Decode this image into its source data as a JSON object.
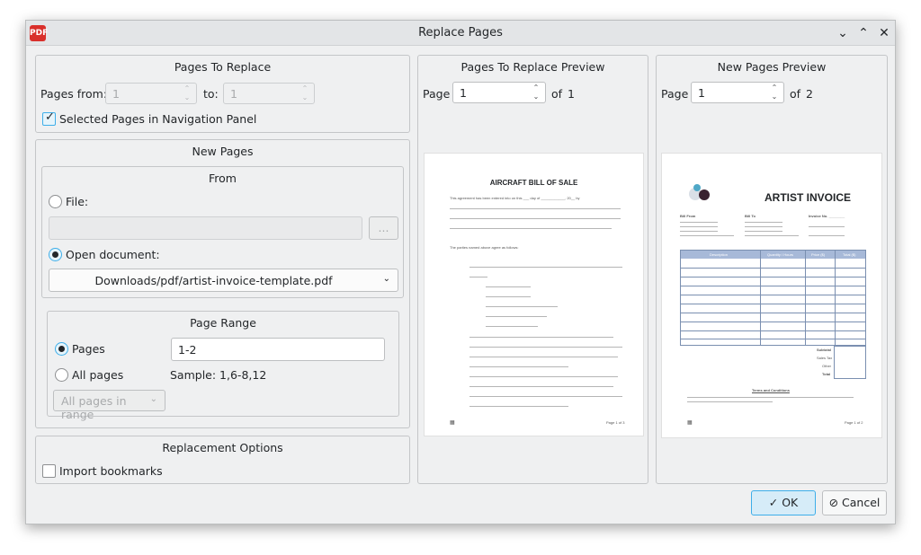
{
  "window": {
    "title": "Replace Pages",
    "app_icon": "pdf-app-icon",
    "controls": [
      "minimize",
      "maximize",
      "close"
    ]
  },
  "pages_to_replace": {
    "title": "Pages To Replace",
    "from_label": "Pages from:",
    "from_value": "1",
    "to_label": "to:",
    "to_value": "1",
    "selected_pages_label": "Selected Pages in Navigation Panel",
    "selected_pages_checked": true
  },
  "new_pages": {
    "title": "New Pages",
    "from_title": "From",
    "file_label": "File:",
    "file_value": "",
    "browse_label": "...",
    "open_document_label": "Open document:",
    "open_document_value": "Downloads/pdf/artist-invoice-template.pdf",
    "page_range": {
      "title": "Page Range",
      "pages_label": "Pages",
      "pages_value": "1-2",
      "all_pages_label": "All pages",
      "sample_label": "Sample: 1,6-8,12",
      "filter_value": "All pages in range"
    }
  },
  "replacement_options": {
    "title": "Replacement Options",
    "import_bookmarks_label": "Import bookmarks",
    "import_bookmarks_checked": false
  },
  "replace_preview": {
    "title": "Pages To Replace Preview",
    "page_label": "Page",
    "page_value": "1",
    "of_label": "of",
    "total": "1",
    "doc": {
      "title": "AIRCRAFT BILL OF SALE",
      "intro": "This agreement has been entered into on this ___ day of ____________, 20__ by",
      "parties": "The parties named above agree as follows:",
      "footer": "Page 1 of 3"
    }
  },
  "new_preview": {
    "title": "New Pages Preview",
    "page_label": "Page",
    "page_value": "1",
    "of_label": "of",
    "total": "2",
    "doc": {
      "title": "ARTIST INVOICE",
      "bill_from": "Bill From",
      "bill_to": "Bill To",
      "invoice_no": "Invoice No. ________",
      "col_description": "Description",
      "col_quantity": "Quantity / Hours",
      "col_price": "Price ($)",
      "col_total": "Total ($)",
      "subtotal": "Subtotal",
      "sales_tax": "Sales Tax",
      "other": "Other",
      "total": "Total",
      "terms": "Terms and Conditions",
      "footer": "Page 1 of 2"
    }
  },
  "buttons": {
    "ok_label": "OK",
    "cancel_label": "Cancel"
  }
}
